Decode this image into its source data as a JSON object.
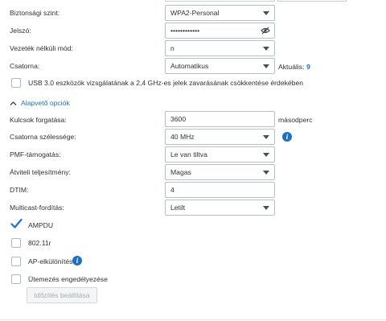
{
  "wifi": {
    "security_label": "Biztonsági szint:",
    "security_value": "WPA2-Personal",
    "password_label": "Jelszó:",
    "password_value": "••••••••••••",
    "mode_label": "Vezeték nélküli mód:",
    "mode_value": "n",
    "channel_label": "Csatorna:",
    "channel_value": "Automatikus",
    "current_label": "Aktuális:",
    "current_value": "9",
    "usb_label": "USB 3.0 eszközök vizsgálatának a 2,4 GHz-es jelek zavarásának csökkentése érdekében"
  },
  "advanced": {
    "toggle_label": "Alapvető opciók",
    "key_rotation_label": "Kulcsok forgatása:",
    "key_rotation_value": "3600",
    "key_rotation_unit": "másodperc",
    "width_label": "Csatorna szélessége:",
    "width_value": "40 MHz",
    "pmf_label": "PMF-támogatás:",
    "pmf_value": "Le van tiltva",
    "power_label": "Átviteli teljesítmény:",
    "power_value": "Magas",
    "dtim_label": "DTIM:",
    "dtim_value": "4",
    "multicast_label": "Multicast-fordítás:",
    "multicast_value": "Letilt"
  },
  "options": [
    {
      "label": "AMPDU",
      "checked": true
    },
    {
      "label": "802.11r",
      "checked": false
    },
    {
      "label": "AP-elkülönítés",
      "checked": false
    },
    {
      "label": "Ütemezés engedélyezése",
      "checked": false
    }
  ],
  "schedule_button": "Időzítés beállítása",
  "colors": {
    "accent": "#1f6fc5",
    "check": "#1f6fc5",
    "border": "#b6bfca"
  }
}
